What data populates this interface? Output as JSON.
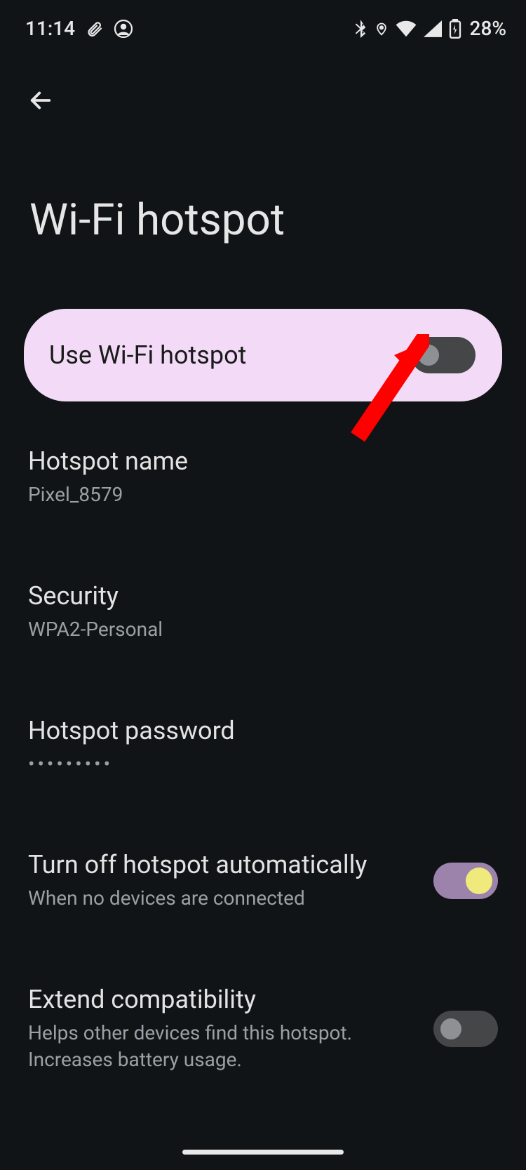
{
  "status_bar": {
    "time": "11:14",
    "battery_text": "28%"
  },
  "header": {
    "title": "Wi-Fi hotspot"
  },
  "primary_toggle": {
    "label": "Use Wi-Fi hotspot",
    "on": false
  },
  "rows": {
    "hotspot_name": {
      "title": "Hotspot name",
      "value": "Pixel_8579"
    },
    "security": {
      "title": "Security",
      "value": "WPA2-Personal"
    },
    "password": {
      "title": "Hotspot password",
      "value": "•••••••••"
    },
    "auto_off": {
      "title": "Turn off hotspot automatically",
      "sub": "When no devices are connected",
      "on": true
    },
    "extend": {
      "title": "Extend compatibility",
      "sub": "Helps other devices find this hotspot. Increases battery usage.",
      "on": false
    }
  }
}
